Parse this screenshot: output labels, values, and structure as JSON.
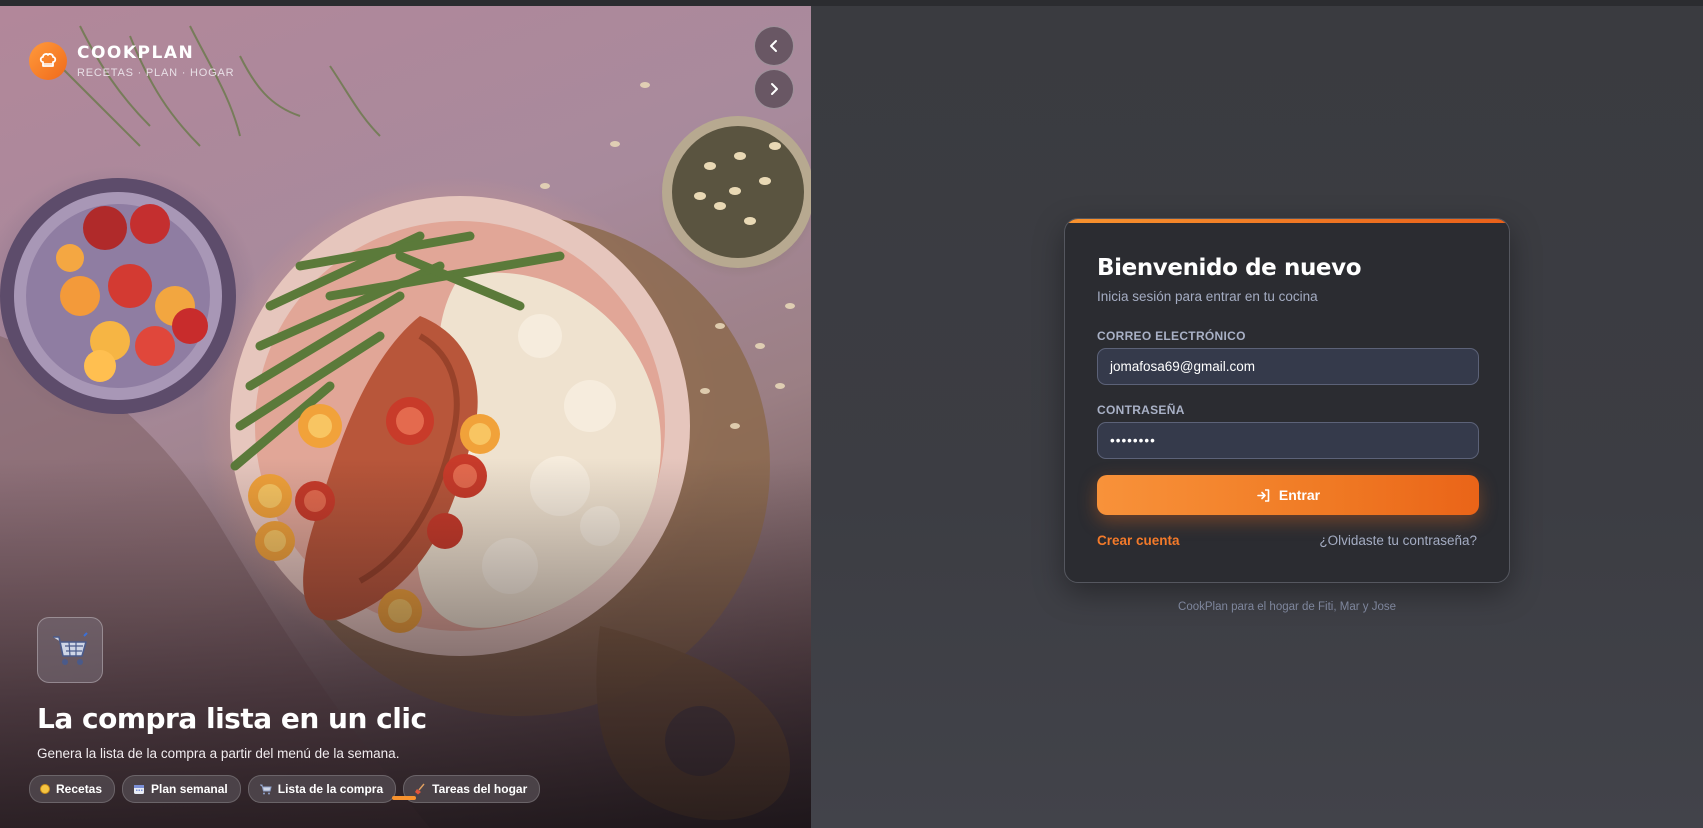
{
  "brand": {
    "name": "COOKPLAN",
    "tagline": "RECETAS · PLAN · HOGAR"
  },
  "hero": {
    "feature_icon": "shopping-cart-icon",
    "title": "La compra lista en un clic",
    "subtitle": "Genera la lista de la compra a partir del menú de la semana.",
    "prev_icon": "chevron-left-icon",
    "next_icon": "chevron-right-icon",
    "chips": [
      {
        "label": "Recetas",
        "icon": "dot-icon"
      },
      {
        "label": "Plan semanal",
        "icon": "calendar-icon"
      },
      {
        "label": "Lista de la compra",
        "icon": "cart-icon"
      },
      {
        "label": "Tareas del hogar",
        "icon": "broom-icon"
      }
    ]
  },
  "login": {
    "title": "Bienvenido de nuevo",
    "subtitle": "Inicia sesión para entrar en tu cocina",
    "email_label": "CORREO ELECTRÓNICO",
    "email_value": "jomafosa69@gmail.com",
    "password_label": "CONTRASEÑA",
    "password_value": "••••••••",
    "submit_label": "Entrar",
    "create_account": "Crear cuenta",
    "forgot_password": "¿Olvidaste tu contraseña?",
    "footer": "CookPlan para el hogar de Fiti, Mar y Jose"
  },
  "colors": {
    "accent": "#f37a2a",
    "card_bg": "#2b2c31",
    "page_bg": "#3a3b40",
    "field_bg": "#353a4b"
  }
}
